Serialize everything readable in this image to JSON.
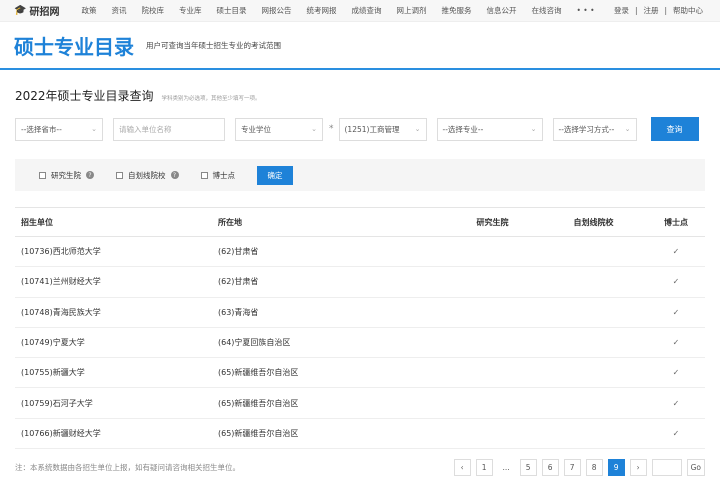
{
  "topbar": {
    "logo": "研招网",
    "nav": [
      "政策",
      "资讯",
      "院校库",
      "专业库",
      "硕士目录",
      "网报公告",
      "统考网报",
      "成绩查询",
      "网上调剂",
      "推免服务",
      "信息公开",
      "在线咨询",
      "• • •"
    ],
    "login": "登录",
    "register": "注册",
    "help": "帮助中心",
    "sep": "|"
  },
  "hero": {
    "title": "硕士专业目录",
    "subtitle": "用户可查询当年硕士招生专业的考试范围"
  },
  "query": {
    "title": "2022年硕士专业目录查询",
    "hint": "学科类别为必选项，其他至少填写一项。",
    "province": "--选择省市--",
    "unit_placeholder": "请输入单位名称",
    "degree": "专业学位",
    "required_mark": "*",
    "category": "(1251)工商管理",
    "major": "--选择专业--",
    "mode": "--选择学习方式--",
    "submit": "查询"
  },
  "filter": {
    "grad_school": "研究生院",
    "self_line": "自划线院校",
    "doctor": "博士点",
    "help": "?",
    "confirm": "确定"
  },
  "table": {
    "headers": [
      "招生单位",
      "所在地",
      "研究生院",
      "自划线院校",
      "博士点"
    ],
    "rows": [
      {
        "unit": "(10736)西北师范大学",
        "loc": "(62)甘肃省",
        "grad": "",
        "self": "",
        "doc": "✓"
      },
      {
        "unit": "(10741)兰州财经大学",
        "loc": "(62)甘肃省",
        "grad": "",
        "self": "",
        "doc": "✓"
      },
      {
        "unit": "(10748)青海民族大学",
        "loc": "(63)青海省",
        "grad": "",
        "self": "",
        "doc": "✓"
      },
      {
        "unit": "(10749)宁夏大学",
        "loc": "(64)宁夏回族自治区",
        "grad": "",
        "self": "",
        "doc": "✓"
      },
      {
        "unit": "(10755)新疆大学",
        "loc": "(65)新疆维吾尔自治区",
        "grad": "",
        "self": "",
        "doc": "✓"
      },
      {
        "unit": "(10759)石河子大学",
        "loc": "(65)新疆维吾尔自治区",
        "grad": "",
        "self": "",
        "doc": "✓"
      },
      {
        "unit": "(10766)新疆财经大学",
        "loc": "(65)新疆维吾尔自治区",
        "grad": "",
        "self": "",
        "doc": "✓"
      }
    ]
  },
  "footer": {
    "note": "注：本系统数据由各招生单位上报，如有疑问请咨询相关招生单位。"
  },
  "pagination": {
    "prev": "‹",
    "pages": [
      "1",
      "...",
      "5",
      "6",
      "7",
      "8",
      "9"
    ],
    "active": "9",
    "next": "›",
    "go": "Go"
  }
}
